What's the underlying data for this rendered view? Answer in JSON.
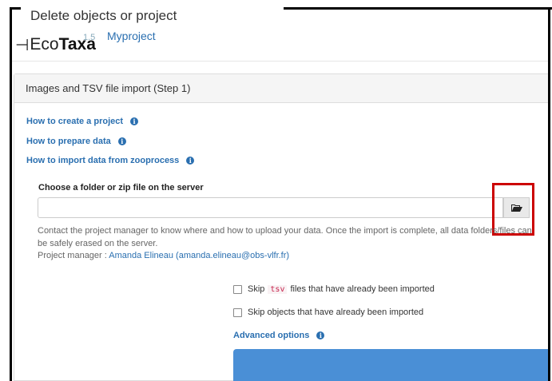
{
  "popup": {
    "title": "Delete objects or project"
  },
  "header": {
    "logo_left": "Eco",
    "logo_right": "Taxa",
    "version": "1.5",
    "project": "Myproject"
  },
  "panel": {
    "heading": "Images and TSV file import (Step 1)",
    "links": [
      {
        "label": "How to create a project"
      },
      {
        "label": "How to prepare data"
      },
      {
        "label": "How to import data from zooprocess"
      }
    ],
    "folder_label": "Choose a folder or zip file on the server",
    "folder_value": "",
    "help_text": "Contact the project manager to know where and how to upload your data. Once the import is complete, all data folders/files can be safely erased on the server.",
    "manager_prefix": "Project manager : ",
    "manager_link": "Amanda Elineau (amanda.elineau@obs-vlfr.fr)",
    "skip_tsv_before": "Skip",
    "skip_tsv_code": "tsv",
    "skip_tsv_after": "files that have already been imported",
    "skip_objects": "Skip objects that have already been imported",
    "advanced_options": "Advanced options"
  },
  "icons": {
    "info": "info-icon",
    "folder": "folder-open-icon"
  },
  "colors": {
    "link": "#2a6fb0",
    "button": "#4a8fd6",
    "highlight": "#cc0000"
  }
}
